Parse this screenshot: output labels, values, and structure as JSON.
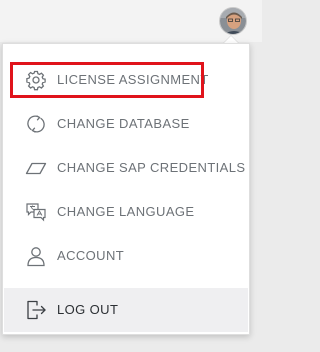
{
  "header": {
    "avatar_icon": "user-avatar-icon"
  },
  "menu": {
    "items": [
      {
        "label": "LICENSE ASSIGNMENT",
        "icon": "gear-icon"
      },
      {
        "label": "CHANGE DATABASE",
        "icon": "sync-icon"
      },
      {
        "label": "CHANGE SAP CREDENTIALS",
        "icon": "credentials-card-icon"
      },
      {
        "label": "CHANGE LANGUAGE",
        "icon": "language-icon"
      },
      {
        "label": "ACCOUNT",
        "icon": "person-icon"
      },
      {
        "label": "LOG OUT",
        "icon": "logout-icon"
      }
    ]
  },
  "colors": {
    "annotation_box": "#e0131b",
    "item_text": "#6d7277",
    "hover_background": "#efeff1"
  }
}
